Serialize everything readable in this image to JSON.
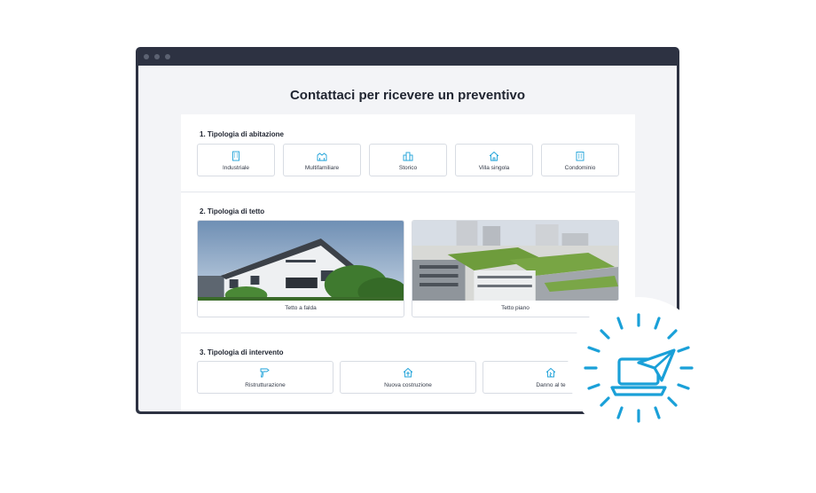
{
  "page": {
    "title": "Contattaci per ricevere un preventivo"
  },
  "section1": {
    "title": "1. Tipologia di abitazione",
    "options": [
      {
        "label": "Industriale",
        "icon": "industrial-building-icon"
      },
      {
        "label": "Multifamiliare",
        "icon": "multifamily-icon"
      },
      {
        "label": "Storico",
        "icon": "historic-building-icon"
      },
      {
        "label": "Villa singola",
        "icon": "house-icon"
      },
      {
        "label": "Condominio",
        "icon": "apartment-building-icon"
      }
    ]
  },
  "section2": {
    "title": "2. Tipologia di tetto",
    "options": [
      {
        "label": "Tetto a falda",
        "image": "pitched-roof-photo"
      },
      {
        "label": "Tetto piano",
        "image": "flat-roof-photo"
      }
    ]
  },
  "section3": {
    "title": "3. Tipologia di intervento",
    "options": [
      {
        "label": "Ristrutturazione",
        "icon": "drill-icon"
      },
      {
        "label": "Nuova costruzione",
        "icon": "new-construction-icon"
      },
      {
        "label": "Danno al te",
        "icon": "damaged-house-icon"
      }
    ]
  },
  "colors": {
    "accent": "#1aa0d8",
    "window_frame": "#2d3242",
    "page_bg": "#f3f4f7"
  }
}
